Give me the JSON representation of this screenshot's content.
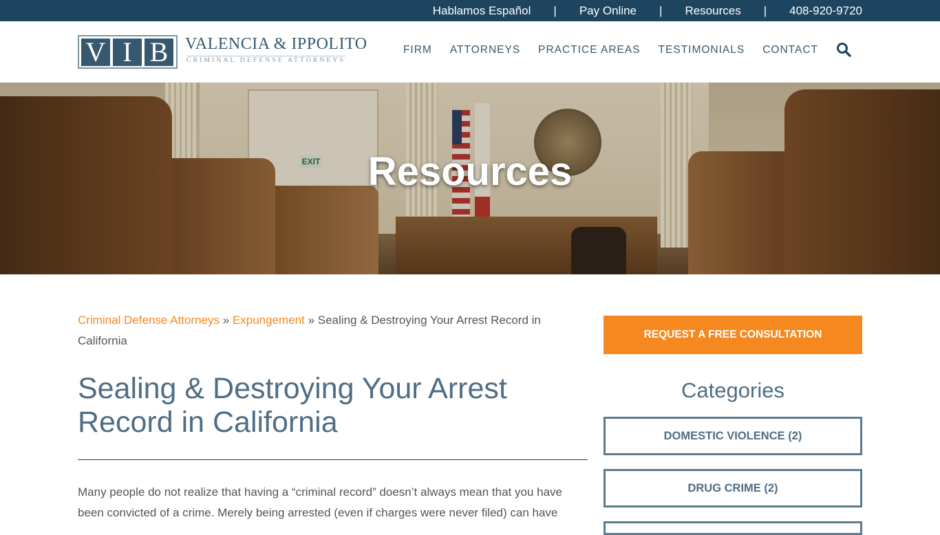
{
  "topbar": {
    "spanish": "Hablamos Español",
    "pay": "Pay Online",
    "resources": "Resources",
    "phone": "408-920-9720",
    "separator": "|"
  },
  "logo": {
    "letters": [
      "V",
      "I",
      "B"
    ],
    "name": "VALENCIA & IPPOLITO",
    "tagline": "CRIMINAL DEFENSE ATTORNEYS"
  },
  "nav": {
    "items": [
      "FIRM",
      "ATTORNEYS",
      "PRACTICE AREAS",
      "TESTIMONIALS",
      "CONTACT"
    ],
    "search_icon": "search-icon"
  },
  "hero": {
    "title": "Resources",
    "exit_sign": "EXIT"
  },
  "breadcrumb": {
    "link1": "Criminal Defense Attorneys",
    "sep": "»",
    "link2": "Expungement",
    "current": "Sealing & Destroying Your Arrest Record in California"
  },
  "article": {
    "title": "Sealing & Destroying Your Arrest Record in California",
    "intro": "Many people do not realize that having a “criminal record” doesn’t always mean that you have been convicted of a crime. Merely being arrested (even if charges were never filed) can have"
  },
  "sidebar": {
    "cta": "REQUEST A FREE CONSULTATION",
    "categories_title": "Categories",
    "categories": [
      "DOMESTIC VIOLENCE (2)",
      "DRUG CRIME (2)"
    ]
  },
  "colors": {
    "brand": "#1e4560",
    "accent": "#f5891f",
    "heading": "#4f6d84"
  }
}
